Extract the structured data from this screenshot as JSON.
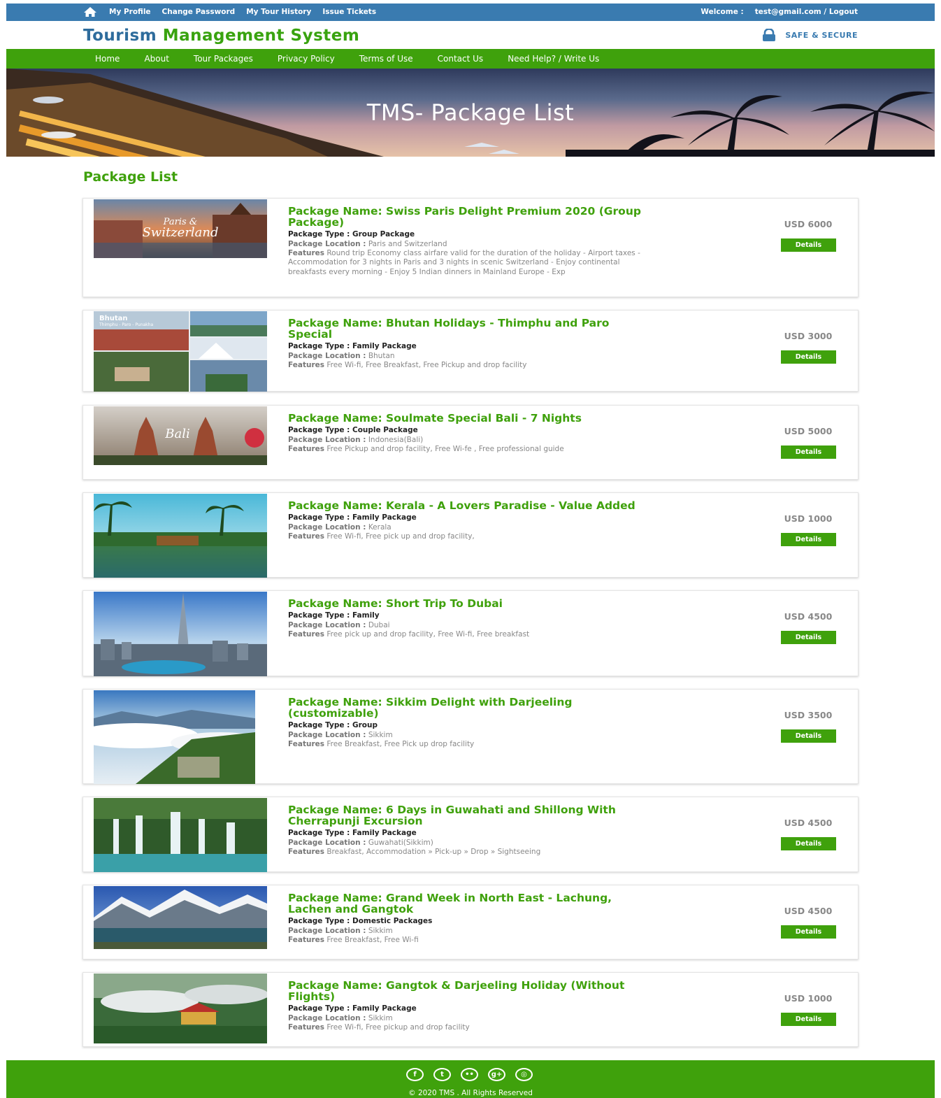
{
  "topbar": {
    "links": [
      "My Profile",
      "Change Password",
      "My Tour History",
      "Issue Tickets"
    ],
    "welcome_label": "Welcome :",
    "account": "test@gmail.com / Logout"
  },
  "brand": {
    "title_part1": "Tourism",
    "title_part2": "Management System",
    "secure_label": "SAFE & SECURE"
  },
  "nav": {
    "items": [
      "Home",
      "About",
      "Tour Packages",
      "Privacy Policy",
      "Terms of Use",
      "Contact Us",
      "Need Help? / Write Us"
    ]
  },
  "banner": {
    "title": "TMS- Package List"
  },
  "section_title": "Package List",
  "labels": {
    "type": "Package Type :",
    "location": "Package Location :",
    "features": "Features",
    "details": "Details"
  },
  "packages": [
    {
      "name": "Package Name: Swiss Paris Delight Premium 2020 (Group Package)",
      "type": "Group Package",
      "location": "Paris and Switzerland",
      "features": "Round trip Economy class airfare valid for the duration of the holiday - Airport taxes - Accommodation for 3 nights in Paris and 3 nights in scenic Switzerland - Enjoy continental breakfasts every morning - Enjoy 5 Indian dinners in Mainland Europe - Exp",
      "price": "USD 6000",
      "image_caption_1": "Paris &",
      "image_caption_2": "Switzerland"
    },
    {
      "name": "Package Name: Bhutan Holidays - Thimphu and Paro Special",
      "type": "Family Package",
      "location": "Bhutan",
      "features": "Free Wi-fi, Free Breakfast, Free Pickup and drop facility",
      "price": "USD 3000",
      "image_caption_1": "Bhutan",
      "image_caption_2": "Thimphu - Paro - Punakha"
    },
    {
      "name": "Package Name: Soulmate Special Bali - 7 Nights",
      "type": "Couple Package",
      "location": "Indonesia(Bali)",
      "features": "Free Pickup and drop facility, Free Wi-fe , Free professional guide",
      "price": "USD 5000",
      "image_caption_1": "Bali"
    },
    {
      "name": "Package Name: Kerala - A Lovers Paradise - Value Added",
      "type": "Family Package",
      "location": "Kerala",
      "features": "Free Wi-fi, Free pick up and drop facility,",
      "price": "USD 1000"
    },
    {
      "name": "Package Name: Short Trip To Dubai",
      "type": "Family",
      "location": "Dubai",
      "features": "Free pick up and drop facility, Free Wi-fi, Free breakfast",
      "price": "USD 4500"
    },
    {
      "name": "Package Name: Sikkim Delight with Darjeeling (customizable)",
      "type": "Group",
      "location": "Sikkim",
      "features": "Free Breakfast, Free Pick up drop facility",
      "price": "USD 3500"
    },
    {
      "name": "Package Name: 6 Days in Guwahati and Shillong With Cherrapunji Excursion",
      "type": "Family Package",
      "location": "Guwahati(Sikkim)",
      "features": "Breakfast, Accommodation » Pick-up » Drop » Sightseeing",
      "price": "USD 4500"
    },
    {
      "name": "Package Name: Grand Week in North East - Lachung, Lachen and Gangtok",
      "type": "Domestic Packages",
      "location": "Sikkim",
      "features": "Free Breakfast, Free Wi-fi",
      "price": "USD 4500"
    },
    {
      "name": "Package Name: Gangtok & Darjeeling Holiday (Without Flights)",
      "type": "Family Package",
      "location": "Sikkim",
      "features": "Free Wi-fi, Free pickup and drop facility",
      "price": "USD 1000"
    }
  ],
  "footer": {
    "social_icons": [
      "facebook-icon",
      "twitter-icon",
      "flickr-icon",
      "google-plus-icon",
      "dribbble-icon"
    ],
    "copyright": "© 2020 TMS . All Rights Reserved"
  },
  "colors": {
    "topbar": "#3a7bb0",
    "brand_green": "#3fa10c",
    "brand_blue": "#2e6c9c"
  }
}
